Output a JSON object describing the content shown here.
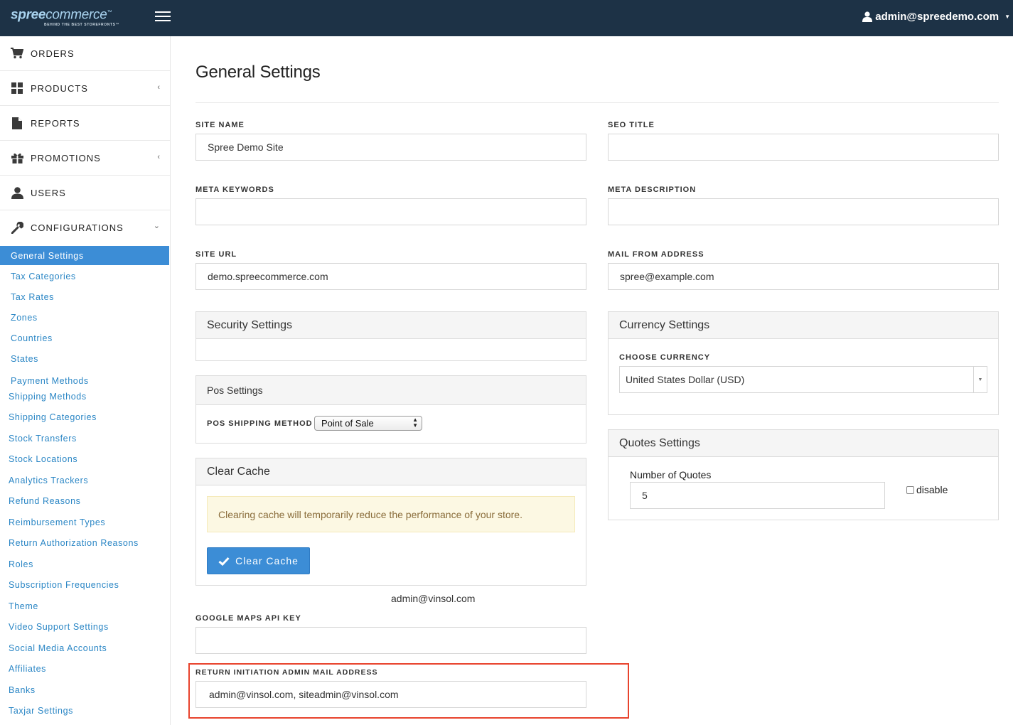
{
  "header": {
    "logo_brand": "spree",
    "logo_rest": "commerce",
    "logo_tm": "™",
    "logo_tagline": "BEHIND THE BEST STOREFRONTS™",
    "user_email": "admin@spreedemo.com"
  },
  "sidebar": {
    "main_items": [
      {
        "label": "ORDERS",
        "icon": "cart-icon"
      },
      {
        "label": "PRODUCTS",
        "icon": "grid-icon"
      },
      {
        "label": "REPORTS",
        "icon": "file-icon"
      },
      {
        "label": "PROMOTIONS",
        "icon": "gift-icon"
      },
      {
        "label": "USERS",
        "icon": "user-icon"
      },
      {
        "label": "CONFIGURATIONS",
        "icon": "wrench-icon"
      }
    ],
    "config_items": [
      "General Settings",
      "Tax Categories",
      "Tax Rates",
      "Zones",
      "Countries",
      "States",
      "Payment Methods",
      "Shipping Methods",
      "Shipping Categories",
      "Stock Transfers",
      "Stock Locations",
      "Analytics Trackers",
      "Refund Reasons",
      "Reimbursement Types",
      "Return Authorization Reasons",
      "Roles",
      "Subscription Frequencies",
      "Theme",
      "Video Support Settings",
      "Social Media Accounts",
      "Affiliates",
      "Banks",
      "Taxjar Settings"
    ]
  },
  "main": {
    "title": "General Settings",
    "site_name": {
      "label": "SITE NAME",
      "value": "Spree Demo Site"
    },
    "seo_title": {
      "label": "SEO TITLE",
      "value": ""
    },
    "meta_keywords": {
      "label": "META KEYWORDS",
      "value": ""
    },
    "meta_description": {
      "label": "META DESCRIPTION",
      "value": ""
    },
    "site_url": {
      "label": "SITE URL",
      "value": "demo.spreecommerce.com"
    },
    "mail_from": {
      "label": "MAIL FROM ADDRESS",
      "value": "spree@example.com"
    },
    "security": {
      "title": "Security Settings"
    },
    "pos": {
      "title": "Pos Settings",
      "label": "POS SHIPPING METHOD",
      "selected": "Point of Sale"
    },
    "cache": {
      "title": "Clear Cache",
      "warning": "Clearing cache will temporarily reduce the performance of your store.",
      "button": "Clear Cache"
    },
    "admin_email_text": "admin@vinsol.com",
    "google_maps": {
      "label": "GOOGLE MAPS API KEY",
      "value": ""
    },
    "return_mail": {
      "label": "RETURN INITIATION ADMIN MAIL ADDRESS",
      "value": "admin@vinsol.com, siteadmin@vinsol.com"
    },
    "currency": {
      "title": "Currency Settings",
      "label": "CHOOSE CURRENCY",
      "selected": "United States Dollar (USD)"
    },
    "quotes": {
      "title": "Quotes Settings",
      "label": "Number of Quotes",
      "value": "5",
      "disable_label": "disable"
    }
  },
  "colors": {
    "header_bg": "#1d3246",
    "accent": "#3c8dd6",
    "highlight": "#e8432d"
  }
}
